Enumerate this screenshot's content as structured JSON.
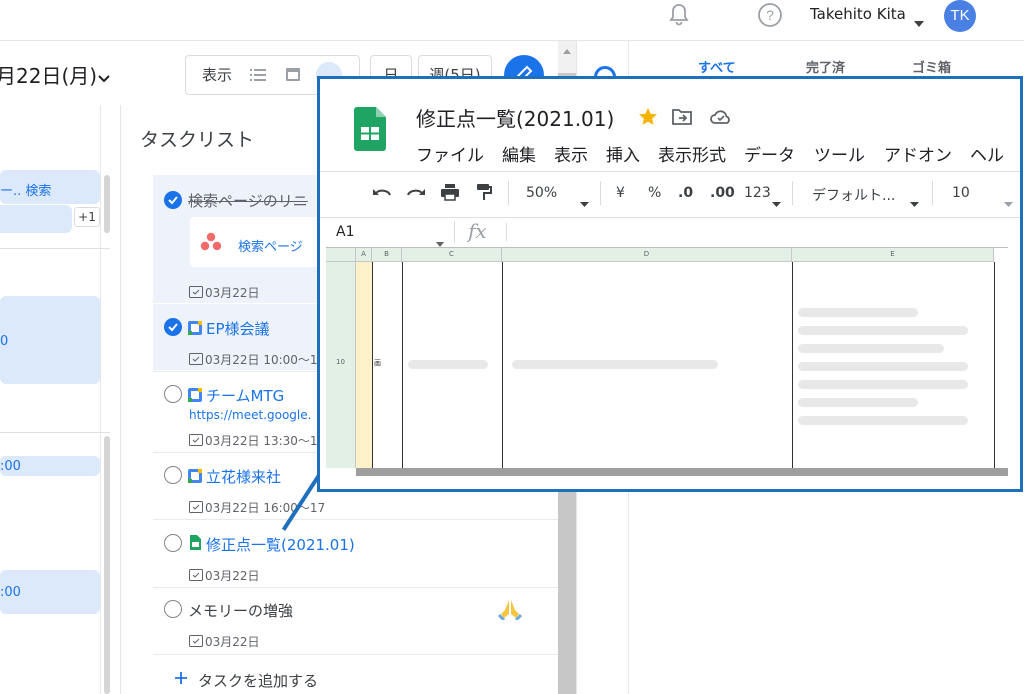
{
  "header": {
    "user_name": "Takehito Kita",
    "avatar_initials": "TK",
    "date": "月22日(月)",
    "view_label": "表示",
    "day_button": "日",
    "week_button": "週(5日)"
  },
  "left_column": {
    "search_item": "ー.. 検索",
    "more_badge": "+1",
    "times": [
      "0",
      ":00",
      ":00"
    ]
  },
  "tasklist": {
    "title": "タスクリスト",
    "add_task": "タスクを追加する",
    "items": [
      {
        "title": "検索ページのリニ",
        "sub": "検索ページ",
        "date": "03月22日",
        "done": true
      },
      {
        "title": "EP様会議",
        "date": "03月22日 10:00〜12",
        "done": true
      },
      {
        "title": "チームMTG",
        "url": "https://meet.google.",
        "date": "03月22日 13:30〜14",
        "done": false
      },
      {
        "title": "立花様来社",
        "date": "03月22日 16:00〜17",
        "done": false
      },
      {
        "title": "修正点一覧(2021.01)",
        "date": "03月22日",
        "done": false
      },
      {
        "title": "メモリーの増強",
        "date": "03月22日",
        "done": false
      }
    ]
  },
  "right_panel": {
    "tabs": [
      "すべて",
      "完了済",
      "ゴミ箱"
    ]
  },
  "sheet_preview": {
    "title": "修正点一覧(2021.01)",
    "menu": [
      "ファイル",
      "編集",
      "表示",
      "挿入",
      "表示形式",
      "データ",
      "ツール",
      "アドオン",
      "ヘル"
    ],
    "toolbar": {
      "zoom": "50%",
      "currency": "¥",
      "percent": "%",
      "dec_less": ".0",
      "dec_more": ".00",
      "format_num": "123",
      "font": "デフォルト...",
      "font_size": "10"
    },
    "cell_ref": "A1",
    "fx": "fx",
    "columns": [
      "A",
      "B",
      "C",
      "D",
      "E"
    ],
    "row_label": "10",
    "cell_b_text": "画"
  },
  "colors": {
    "accent": "#1a73e8",
    "popup_border": "#1e6fbe",
    "sheets_green": "#1fa463",
    "star": "#f4b400"
  }
}
